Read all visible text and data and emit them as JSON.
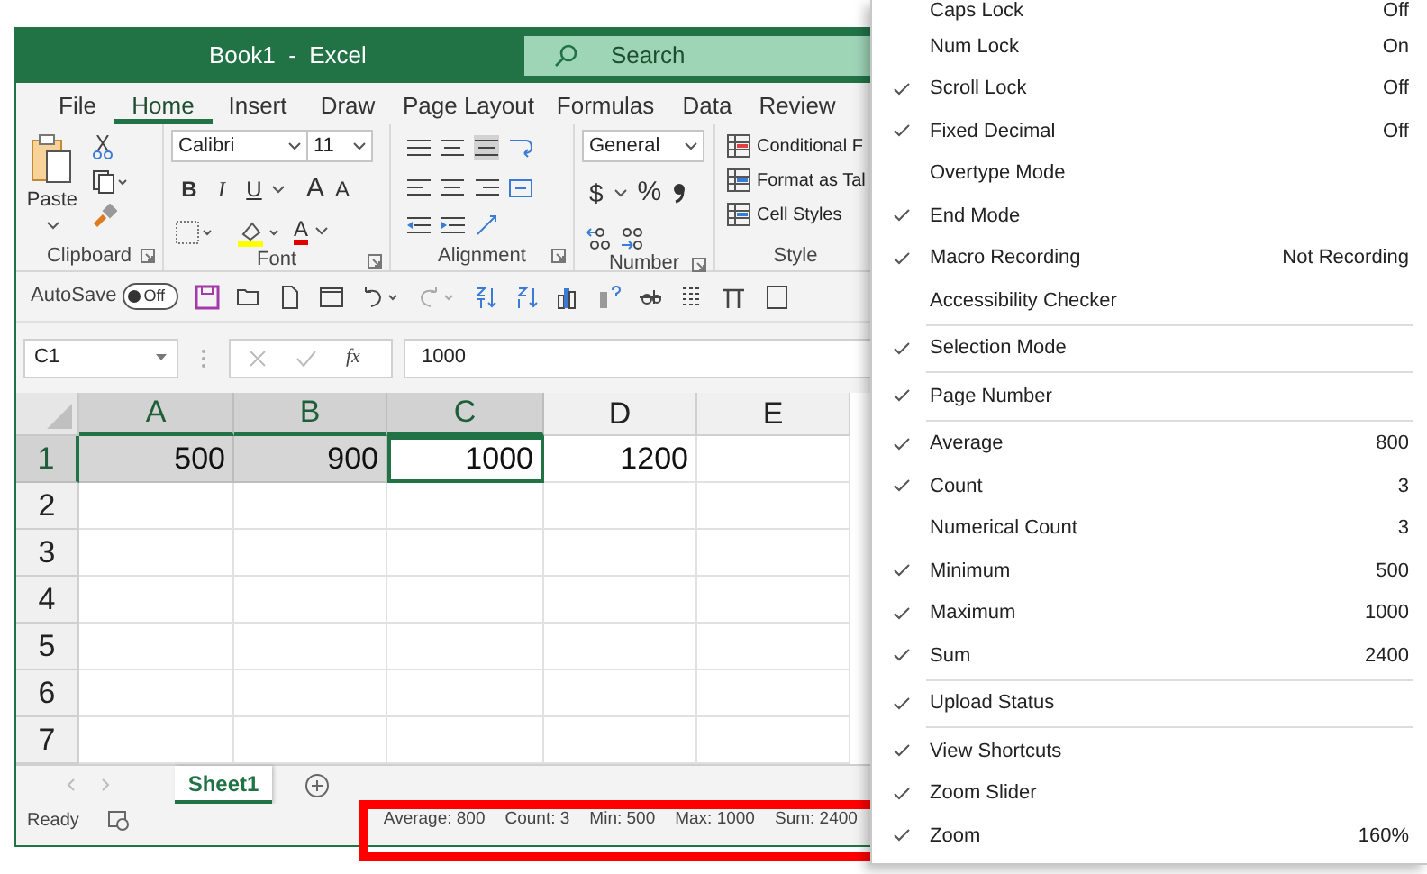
{
  "window": {
    "title": "Book1  -  Excel",
    "search": {
      "placeholder": "Search"
    }
  },
  "ribbon_tabs": [
    {
      "label": "File",
      "selected": false
    },
    {
      "label": "Home",
      "selected": true
    },
    {
      "label": "Insert",
      "selected": false
    },
    {
      "label": "Draw",
      "selected": false
    },
    {
      "label": "Page Layout",
      "selected": false
    },
    {
      "label": "Formulas",
      "selected": false
    },
    {
      "label": "Data",
      "selected": false
    },
    {
      "label": "Review",
      "selected": false
    }
  ],
  "ribbon": {
    "paste_label": "Paste",
    "font_name": "Calibri",
    "font_size": "11",
    "font_buttons": [
      "B",
      "I",
      "U"
    ],
    "size_buttons": [
      "A",
      "A"
    ],
    "font_color_label": "A",
    "number_format": "General",
    "number_buttons": [
      "$",
      "%"
    ],
    "style_buttons": [
      "Conditional F",
      "Format as Tal",
      "Cell Styles"
    ],
    "groups": [
      "Clipboard",
      "Font",
      "Alignment",
      "Number",
      "Style"
    ]
  },
  "quick_access": {
    "autosave_label": "AutoSave",
    "autosave_toggle": {
      "label": "Off",
      "on": false
    }
  },
  "formula_bar": {
    "name_box": "C1",
    "fx": "fx",
    "value": "1000"
  },
  "sheet": {
    "columns": [
      {
        "label": "A",
        "selected": true
      },
      {
        "label": "B",
        "selected": true
      },
      {
        "label": "C",
        "selected": true
      },
      {
        "label": "D",
        "selected": false
      },
      {
        "label": "E",
        "selected": false
      }
    ],
    "rows": [
      {
        "label": "1",
        "selected": true,
        "cells": [
          {
            "value": "500",
            "selected": true,
            "active": false
          },
          {
            "value": "900",
            "selected": true,
            "active": false
          },
          {
            "value": "1000",
            "selected": true,
            "active": true
          },
          {
            "value": "1200",
            "selected": false,
            "active": false
          },
          {
            "selected": false,
            "active": false
          }
        ]
      },
      {
        "label": "2",
        "selected": false
      },
      {
        "label": "3",
        "selected": false
      },
      {
        "label": "4",
        "selected": false
      },
      {
        "label": "5",
        "selected": false
      },
      {
        "label": "6",
        "selected": false
      },
      {
        "label": "7",
        "selected": false
      }
    ]
  },
  "sheet_tabs": [
    {
      "label": "Sheet1",
      "selected": true
    }
  ],
  "status_bar": {
    "mode": "Ready",
    "stats": [
      "Average: 800",
      "Count: 3",
      "Min: 500",
      "Max: 1000",
      "Sum: 2400"
    ]
  },
  "context_menu": {
    "groups": [
      [
        {
          "label": "Caps Lock",
          "value": "Off",
          "checked": false
        },
        {
          "label": "Num Lock",
          "value": "On",
          "checked": false
        },
        {
          "label": "Scroll Lock",
          "value": "Off",
          "checked": true
        },
        {
          "label": "Fixed Decimal",
          "value": "Off",
          "checked": true
        },
        {
          "label": "Overtype Mode",
          "checked": false
        },
        {
          "label": "End Mode",
          "checked": true
        },
        {
          "label": "Macro Recording",
          "value": "Not Recording",
          "checked": true
        },
        {
          "label": "Accessibility Checker",
          "checked": false
        }
      ],
      [
        {
          "label": "Selection Mode",
          "checked": true
        }
      ],
      [
        {
          "label": "Page Number",
          "checked": true
        }
      ],
      [
        {
          "label": "Average",
          "value": "800",
          "checked": true
        },
        {
          "label": "Count",
          "value": "3",
          "checked": true
        },
        {
          "label": "Numerical Count",
          "value": "3",
          "checked": false
        },
        {
          "label": "Minimum",
          "value": "500",
          "checked": true
        },
        {
          "label": "Maximum",
          "value": "1000",
          "checked": true
        },
        {
          "label": "Sum",
          "value": "2400",
          "checked": true
        }
      ],
      [
        {
          "label": "Upload Status",
          "checked": true
        }
      ],
      [
        {
          "label": "View Shortcuts",
          "checked": true
        },
        {
          "label": "Zoom Slider",
          "checked": true
        },
        {
          "label": "Zoom",
          "value": "160%",
          "checked": true
        }
      ]
    ]
  }
}
